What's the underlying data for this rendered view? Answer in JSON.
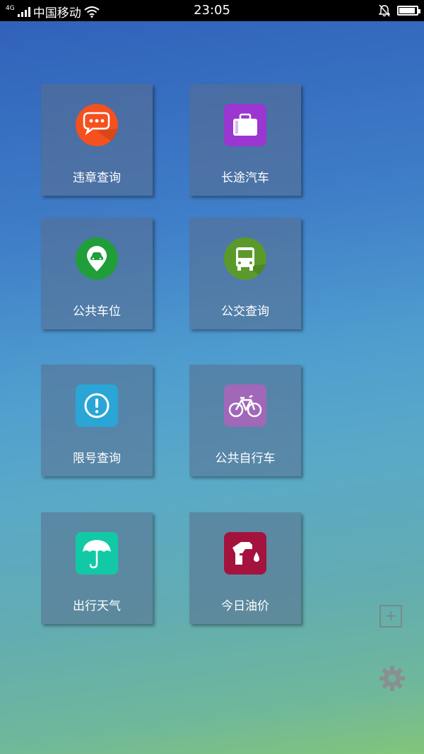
{
  "status_bar": {
    "network": "4G",
    "carrier": "中国移动",
    "time": "23:05"
  },
  "tiles": [
    {
      "label": "违章查询",
      "icon": "chat-bubble-icon",
      "color": "#f4511e"
    },
    {
      "label": "长途汽车",
      "icon": "suitcase-icon",
      "color": "#9b36d0"
    },
    {
      "label": "公共车位",
      "icon": "car-location-pin-icon",
      "color": "#1f9e3a"
    },
    {
      "label": "公交查询",
      "icon": "bus-icon",
      "color": "#5b9a2a"
    },
    {
      "label": "限号查询",
      "icon": "exclamation-circle-icon",
      "color": "#2aa6d6"
    },
    {
      "label": "公共自行车",
      "icon": "bicycle-icon",
      "color": "#a167b8"
    },
    {
      "label": "出行天气",
      "icon": "umbrella-icon",
      "color": "#12c9a6"
    },
    {
      "label": "今日油价",
      "icon": "fuel-nozzle-icon",
      "color": "#a4123e"
    }
  ],
  "side_controls": {
    "add_symbol": "+",
    "settings_icon": "gear-icon"
  }
}
